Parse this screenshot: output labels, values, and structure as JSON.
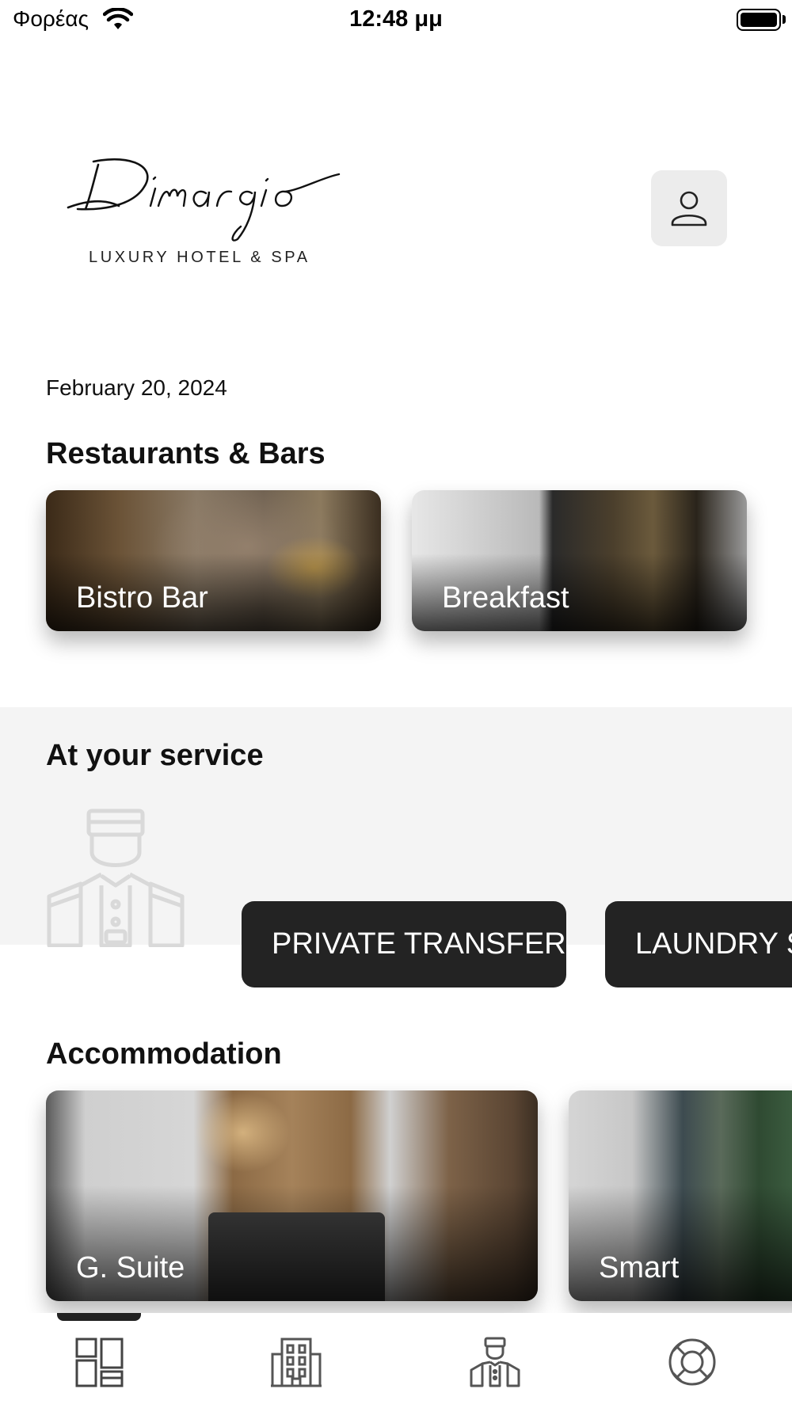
{
  "status_bar": {
    "carrier": "Φορέας",
    "time": "12:48 μμ"
  },
  "header": {
    "logo_script": "Dimargio",
    "logo_subtitle": "LUXURY HOTEL & SPA",
    "profile_icon": "person-icon"
  },
  "date": "February 20, 2024",
  "restaurants": {
    "title": "Restaurants & Bars",
    "items": [
      {
        "label": "Bistro Bar"
      },
      {
        "label": "Breakfast"
      }
    ]
  },
  "services": {
    "title": "At your service",
    "icon": "concierge-icon",
    "items": [
      {
        "label": "PRIVATE TRANSFER"
      },
      {
        "label": "LAUNDRY SE"
      }
    ]
  },
  "accommodation": {
    "title": "Accommodation",
    "items": [
      {
        "label": "G. Suite"
      },
      {
        "label": "Smart"
      }
    ]
  },
  "tab_bar": {
    "tabs": [
      {
        "icon": "dashboard-icon",
        "selected": true
      },
      {
        "icon": "hotel-building-icon",
        "selected": false
      },
      {
        "icon": "concierge-icon",
        "selected": false
      },
      {
        "icon": "lifebuoy-icon",
        "selected": false
      }
    ]
  },
  "colors": {
    "accent_dark": "#232323",
    "service_band": "#f4f4f4",
    "profile_button_bg": "#ececec"
  }
}
